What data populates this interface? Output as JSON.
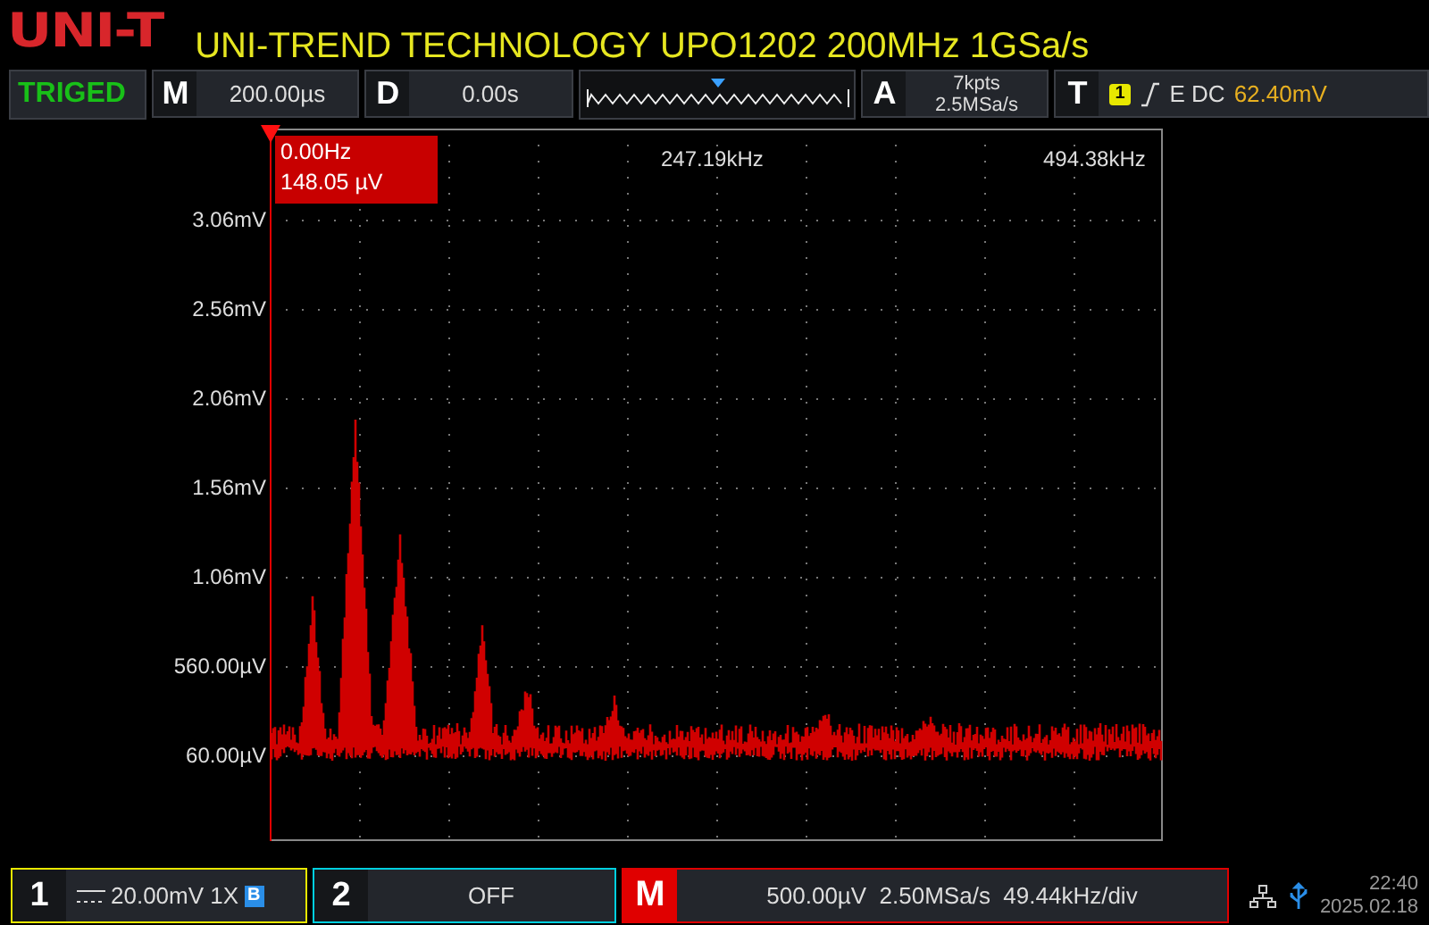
{
  "brand": {
    "logo": "UNI-T",
    "title": "UNI-TREND TECHNOLOGY UPO1202 200MHz 1GSa/s"
  },
  "top_bar": {
    "trigger_status": "TRIGED",
    "timebase": {
      "label": "M",
      "value": "200.00µs"
    },
    "delay": {
      "label": "D",
      "value": "0.00s"
    },
    "acquire": {
      "label": "A",
      "memory_depth": "7kpts",
      "sample_rate": "2.5MSa/s"
    },
    "trigger": {
      "label": "T",
      "source": "1",
      "mode": "E DC",
      "level": "62.40mV"
    }
  },
  "spectrum": {
    "cursor_readout": {
      "frequency": "0.00Hz",
      "amplitude": "148.05 µV"
    },
    "frequency_labels": [
      "247.19kHz",
      "494.38kHz"
    ],
    "amplitude_labels": [
      "3.06mV",
      "2.56mV",
      "2.06mV",
      "1.56mV",
      "1.06mV",
      "560.00µV",
      "60.00µV"
    ]
  },
  "bottom_bar": {
    "channels": [
      {
        "number": "1",
        "kind": "on",
        "scale": "20.00mV 1X",
        "bandwidth_badge": "B",
        "color": "#e8e800"
      },
      {
        "number": "2",
        "kind": "off",
        "scale": "OFF",
        "color": "#00d0e0"
      }
    ],
    "math": {
      "label": "M",
      "settings": "500.00µV  2.50MSa/s  49.44kHz/div"
    },
    "time": "22:40",
    "date": "2025.02.18"
  }
}
